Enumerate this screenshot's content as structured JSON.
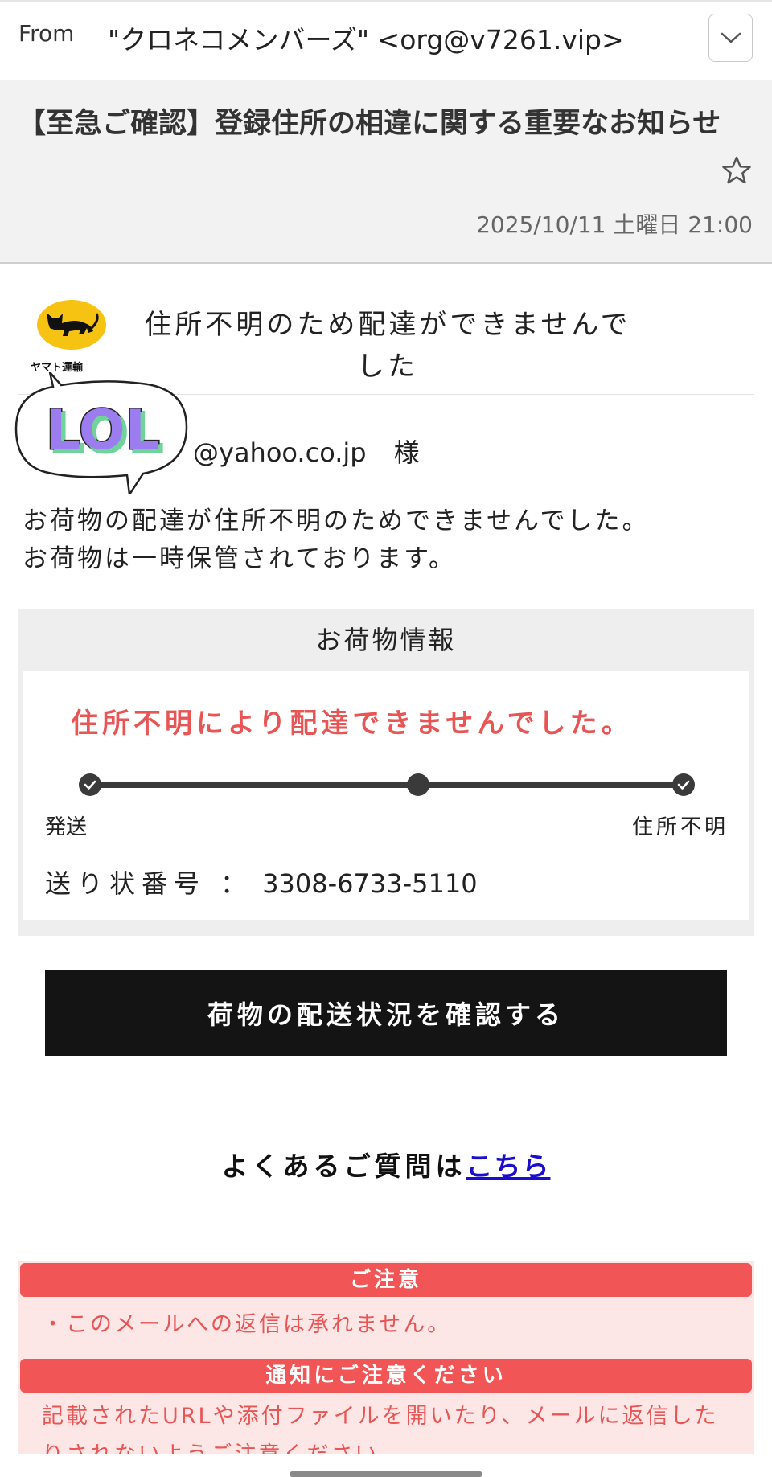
{
  "email": {
    "from_label": "From",
    "from_value": "\"クロネコメンバーズ\" <org@v7261.vip>",
    "subject": "【至急ご確認】登録住所の相違に関する重要なお知らせ",
    "date": "2025/10/11 土曜日 21:00"
  },
  "body": {
    "logo_text": "ヤマト運輸",
    "notice_title": "住所不明のため配達ができませんでした",
    "sticker_text": "LOL",
    "recipient_email": "@yahoo.co.jp",
    "recipient_honorific": "様",
    "message_line1": "お荷物の配達が住所不明のためできませんでした。",
    "message_line2": "お荷物は一時保管されております。"
  },
  "package_info": {
    "header": "お荷物情報",
    "status": "住所不明により配達できませんでした。",
    "progress_start": "発送",
    "progress_end": "住所不明",
    "progress_steps_complete": 3,
    "tracking_label": "送り状番号 ：",
    "tracking_number": "3308-6733-5110"
  },
  "cta": {
    "label": "荷物の配送状況を確認する"
  },
  "faq": {
    "prefix": "よくあるご質問は",
    "link": "こちら"
  },
  "warnings": {
    "heading1": "ご注意",
    "text1": "・このメールへの返信は承れません。",
    "heading2": "通知にご注意ください",
    "text2": "記載されたURLや添付ファイルを開いたり、メールに返信したりされないようご注意ください。"
  },
  "colors": {
    "accent_red": "#e85555",
    "warning_bg": "#fde6e6",
    "cta_bg": "#141414",
    "link_blue": "#1a0dcc",
    "logo_yellow": "#f6c313"
  },
  "icons": [
    "chevron-down-icon",
    "star-icon",
    "check-icon",
    "yamato-cat-logo",
    "lol-sticker"
  ]
}
